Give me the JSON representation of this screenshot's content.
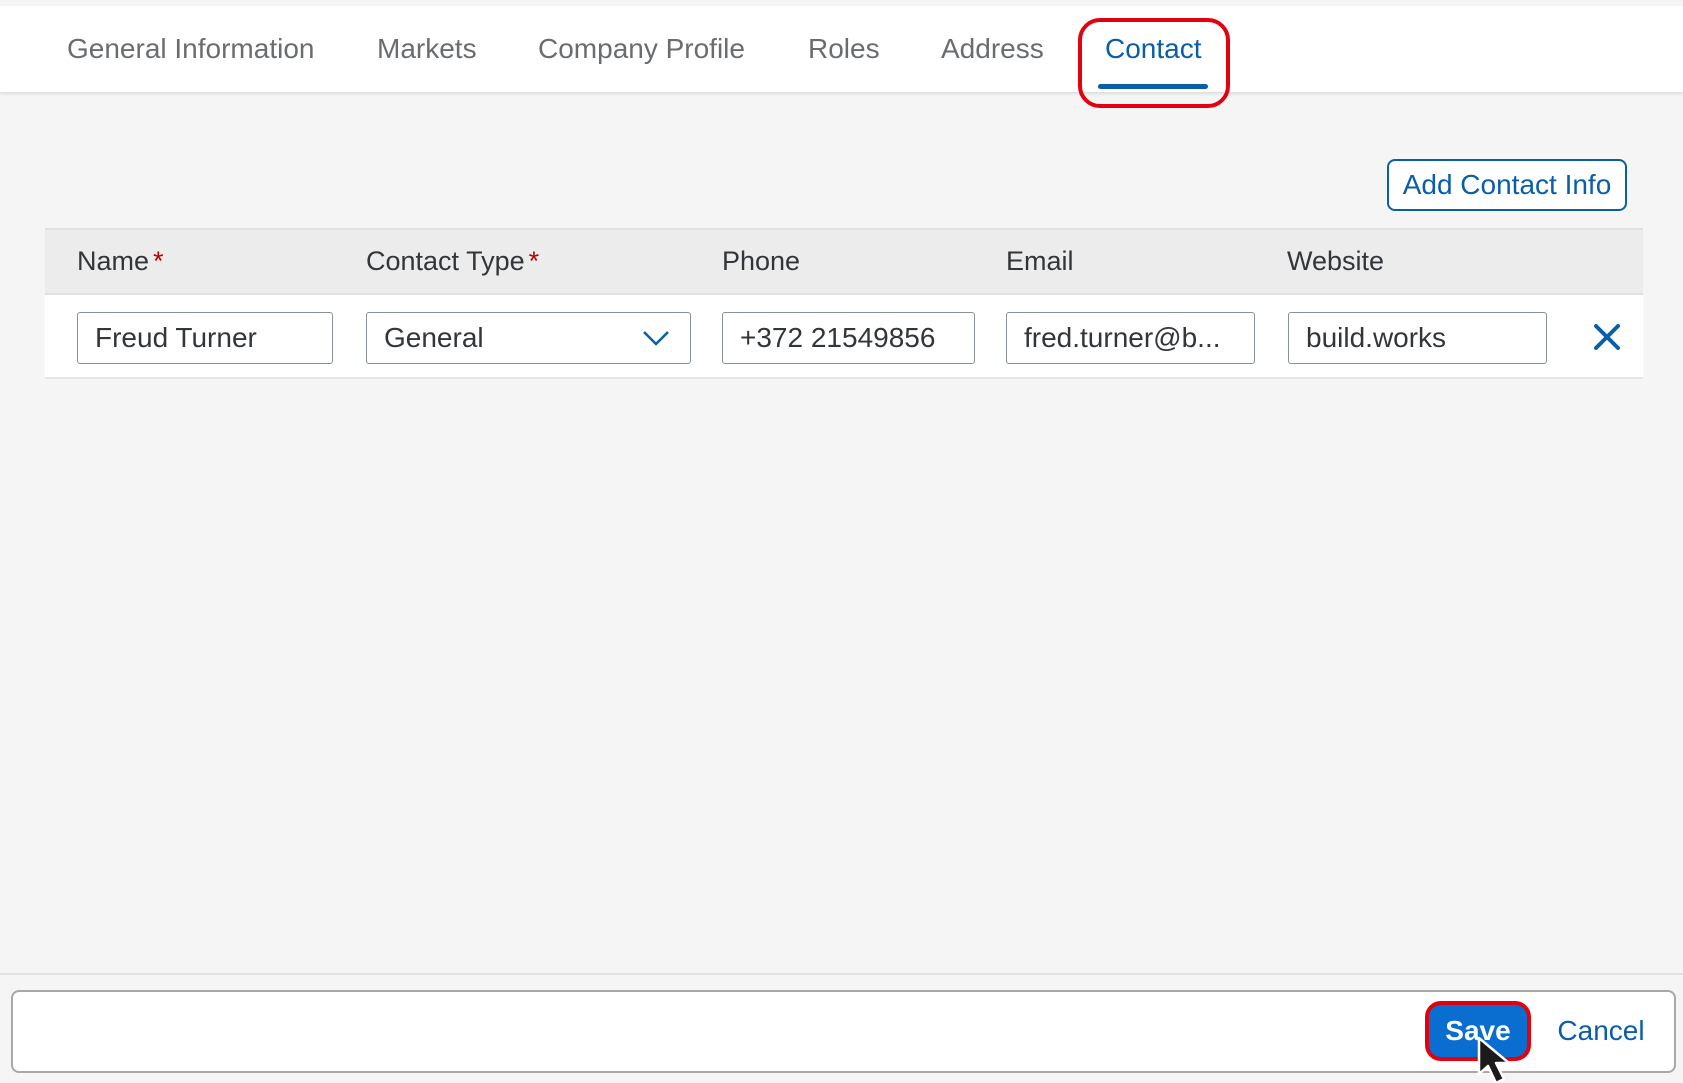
{
  "tabs": [
    {
      "label": "General Information",
      "active": false
    },
    {
      "label": "Markets",
      "active": false
    },
    {
      "label": "Company Profile",
      "active": false
    },
    {
      "label": "Roles",
      "active": false
    },
    {
      "label": "Address",
      "active": false
    },
    {
      "label": "Contact",
      "active": true
    }
  ],
  "toolbar": {
    "add_label": "Add Contact Info"
  },
  "table": {
    "columns": [
      {
        "label": "Name",
        "required": "*"
      },
      {
        "label": "Contact Type",
        "required": "*"
      },
      {
        "label": "Phone",
        "required": ""
      },
      {
        "label": "Email",
        "required": ""
      },
      {
        "label": "Website",
        "required": ""
      }
    ],
    "rows": [
      {
        "name": "Freud Turner",
        "contact_type": "General",
        "phone": "+372 21549856",
        "email": "fred.turner@b...",
        "website": "build.works"
      }
    ]
  },
  "footer": {
    "save_label": "Save",
    "cancel_label": "Cancel"
  },
  "colors": {
    "accent": "#0a5ea8",
    "highlight": "#e3000f",
    "primary_button": "#0a6ed1",
    "required": "#bb0000"
  },
  "icons": {
    "delete": "close-icon",
    "dropdown": "chevron-down-icon",
    "cursor": "mouse-pointer-icon"
  }
}
